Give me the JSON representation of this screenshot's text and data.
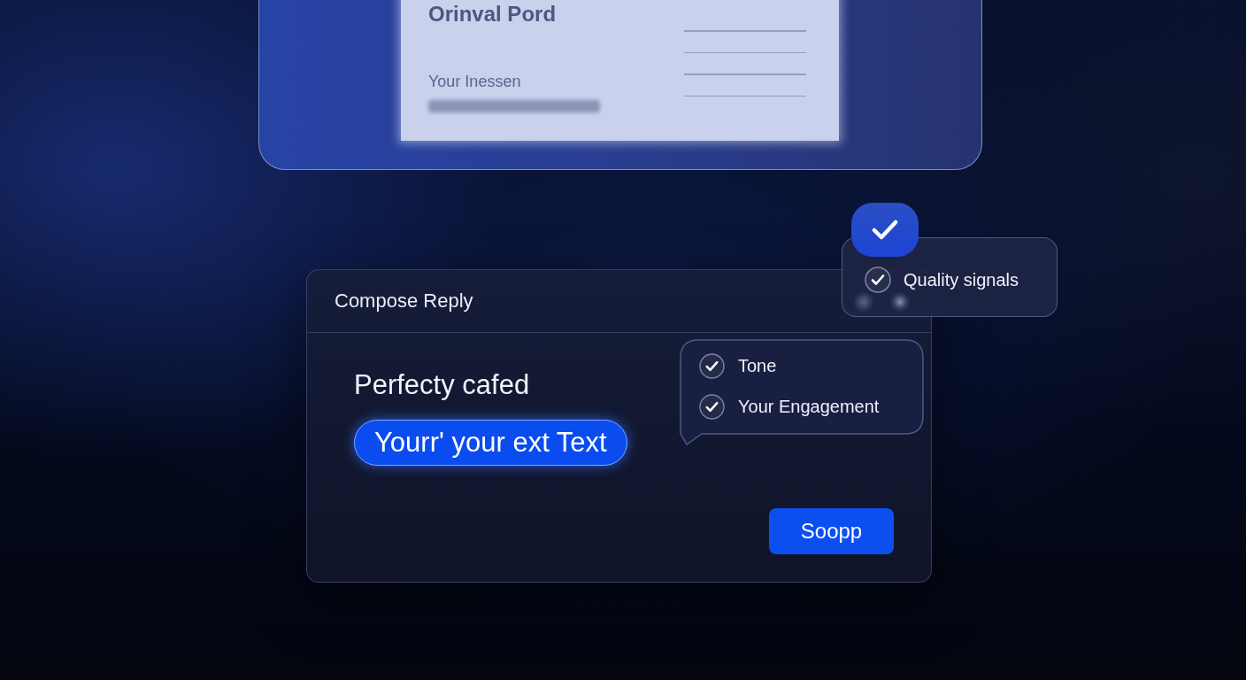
{
  "document_preview": {
    "title": "Orinval Pord",
    "lines": [
      "Your Inessen"
    ]
  },
  "quality_signals": {
    "label": "Quality signals",
    "checked": true
  },
  "compose": {
    "title": "Compose Reply",
    "text": "Perfecty cafed",
    "highlight": "Yourr' your ext Text",
    "suggestions": [
      {
        "label": "Tone",
        "checked": true
      },
      {
        "label": "Your Engagement",
        "checked": true
      }
    ],
    "button": "Soopp"
  }
}
